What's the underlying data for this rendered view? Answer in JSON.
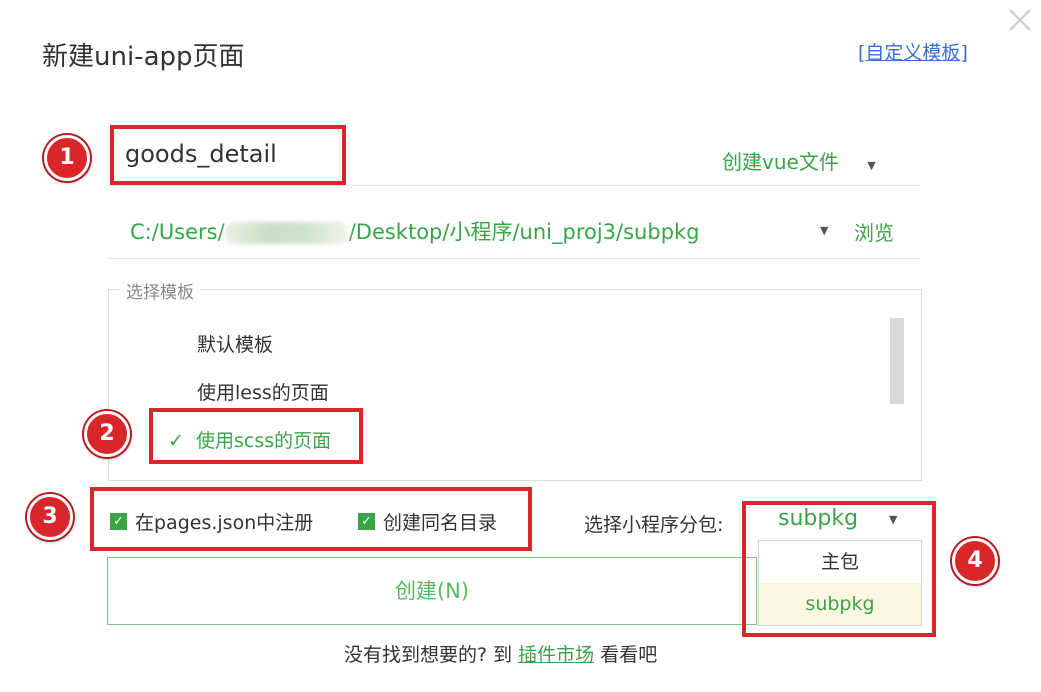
{
  "dialog": {
    "title": "新建uni-app页面",
    "custom_template_link": "自定义模板",
    "bracket_open": "[",
    "bracket_close": "]"
  },
  "form": {
    "page_name": "goods_detail",
    "file_type": "创建vue文件",
    "path_prefix": "C:/Users/",
    "path_suffix": "/Desktop/小程序/uni_proj3/subpkg",
    "browse_label": "浏览"
  },
  "templates": {
    "legend": "选择模板",
    "items": [
      {
        "label": "默认模板",
        "checked": false
      },
      {
        "label": "使用less的页面",
        "checked": false
      },
      {
        "label": "使用scss的页面",
        "checked": true
      }
    ],
    "check_mark": "✓"
  },
  "options": {
    "register_pages_json": "在pages.json中注册",
    "create_same_dir": "创建同名目录",
    "subpackage_label": "选择小程序分包:",
    "subpackage_value": "subpkg"
  },
  "subpackage_dropdown": {
    "items": [
      "主包",
      "subpkg"
    ],
    "highlighted_index": 1
  },
  "create_button": "创建(N)",
  "footer": {
    "text_before": "没有找到想要的? 到 ",
    "link": "插件市场",
    "text_after": " 看看吧"
  },
  "annotations": {
    "badges": [
      "1",
      "2",
      "3",
      "4"
    ],
    "color": "#d9262b"
  },
  "colors": {
    "accent_green": "#3aa548",
    "link_blue": "#3a6fd0",
    "annotation_red": "#d9262b"
  }
}
